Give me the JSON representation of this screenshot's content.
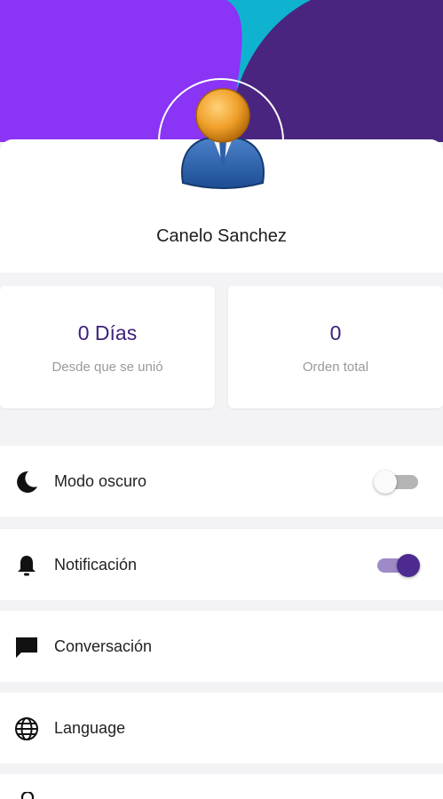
{
  "profile": {
    "name": "Canelo Sanchez"
  },
  "stats": [
    {
      "value": "0 Días",
      "label": "Desde que se unió"
    },
    {
      "value": "0",
      "label": "Orden total"
    }
  ],
  "settings": [
    {
      "label": "Modo oscuro",
      "icon": "moon-icon",
      "toggle": false
    },
    {
      "label": "Notificación",
      "icon": "bell-icon",
      "toggle": true
    },
    {
      "label": "Conversación",
      "icon": "chat-icon"
    },
    {
      "label": "Language",
      "icon": "globe-icon"
    }
  ],
  "colors": {
    "header_primary": "#8a34f5",
    "header_dark": "#4a2580",
    "header_accent": "#0fb3cf",
    "stat_value": "#3d1f7a",
    "toggle_on": "#4d2a8f"
  }
}
